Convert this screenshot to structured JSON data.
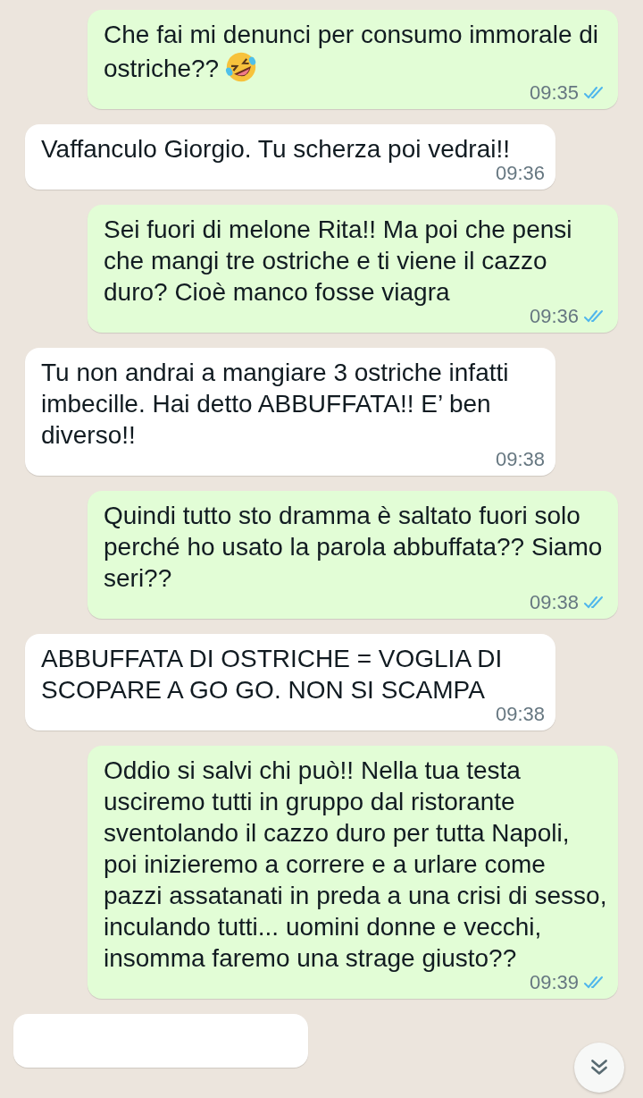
{
  "messages": [
    {
      "sent": true,
      "text": "Che fai mi denunci per consumo immorale di ostriche??",
      "emoji": true,
      "time": "09:35",
      "read": true
    },
    {
      "sent": false,
      "text": "Vaffanculo Giorgio. Tu scherza poi vedrai!!",
      "time": "09:36"
    },
    {
      "sent": true,
      "text": "Sei fuori di melone Rita!! Ma poi che pensi che mangi tre ostriche e ti viene il cazzo duro? Cioè manco fosse viagra",
      "time": "09:36",
      "read": true
    },
    {
      "sent": false,
      "text": "Tu non andrai a mangiare 3 ostriche infatti imbecille. Hai detto ABBUFFATA!! E’ ben diverso!!",
      "time": "09:38"
    },
    {
      "sent": true,
      "text": "Quindi tutto sto dramma è saltato fuori solo perché ho usato la parola abbuffata?? Siamo seri??",
      "time": "09:38",
      "read": true
    },
    {
      "sent": false,
      "text": "ABBUFFATA DI OSTRICHE = VOGLIA DI SCOPARE A GO GO. NON SI SCAMPA",
      "time": "09:38"
    },
    {
      "sent": true,
      "text": "Oddio si salvi chi può!! Nella tua testa usciremo tutti in gruppo dal ristorante sventolando il cazzo duro per tutta Napoli, poi inizieremo a correre e a urlare come pazzi assatanati in preda a una crisi di sesso, inculando tutti... uomini donne e vecchi, insomma faremo una strage giusto??",
      "time": "09:39",
      "read": true
    },
    {
      "sent": false
    }
  ]
}
